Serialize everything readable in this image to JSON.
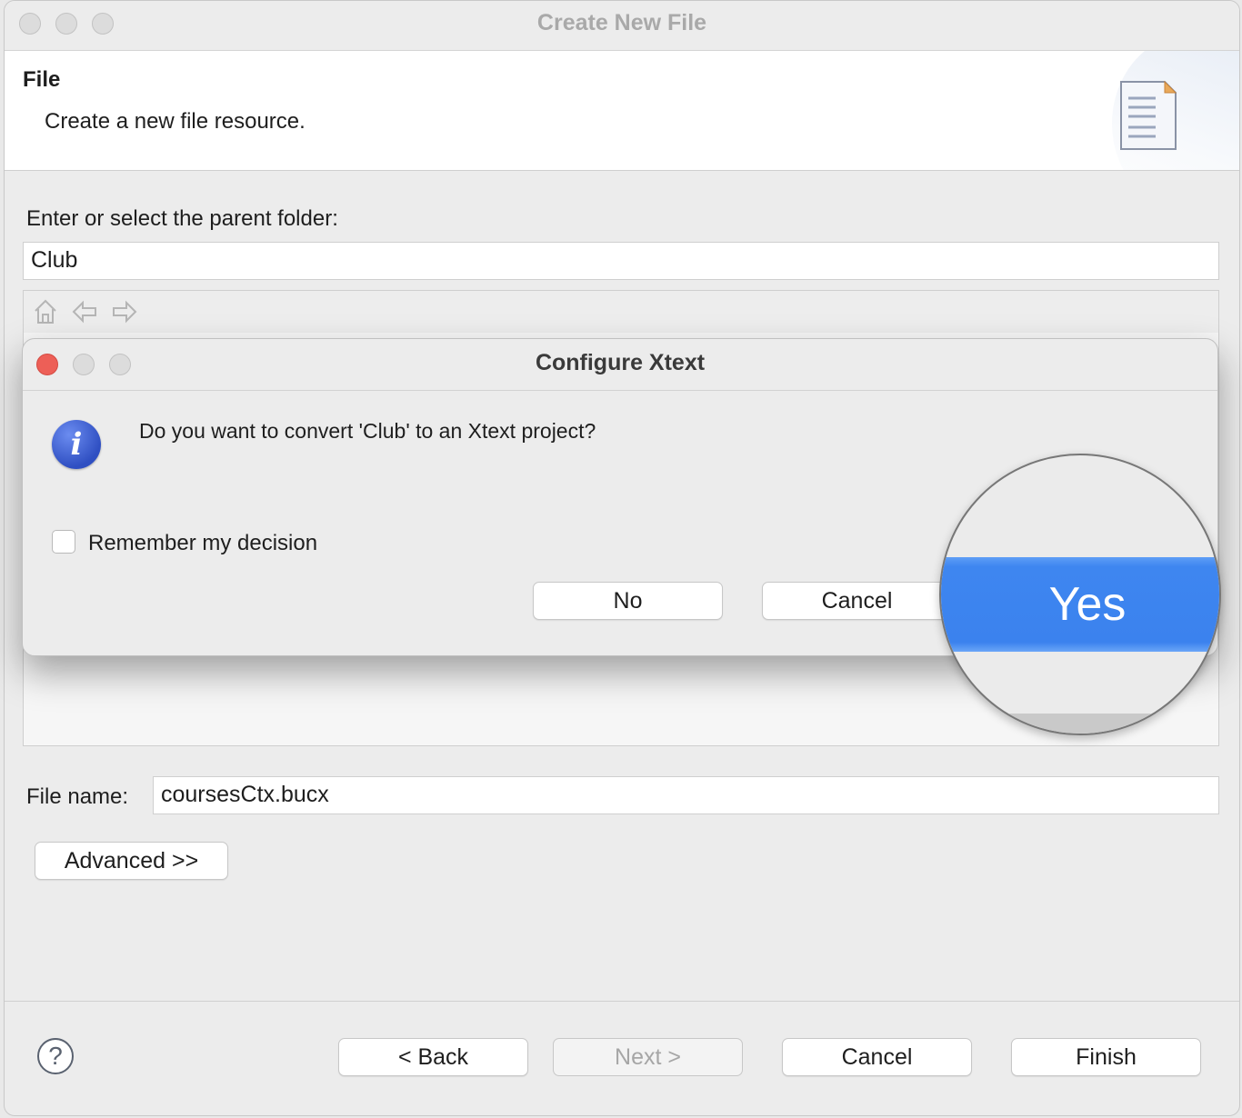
{
  "window": {
    "title": "Create New File"
  },
  "banner": {
    "title": "File",
    "description": "Create a new file resource."
  },
  "parent_folder": {
    "label": "Enter or select the parent folder:",
    "value": "Club"
  },
  "tree_toolbar": {
    "icons": [
      "home-icon",
      "back-arrow-icon",
      "forward-arrow-icon"
    ]
  },
  "file_name": {
    "label": "File name:",
    "value": "coursesCtx.bucx"
  },
  "advanced_button": "Advanced >>",
  "footer": {
    "help_label": "?",
    "back_label": "< Back",
    "next_label": "Next >",
    "cancel_label": "Cancel",
    "finish_label": "Finish"
  },
  "dialog": {
    "title": "Configure Xtext",
    "icon": "info-icon",
    "message": "Do you want to convert 'Club' to an Xtext project?",
    "remember_label": "Remember my decision",
    "remember_checked": false,
    "no_label": "No",
    "cancel_label": "Cancel",
    "yes_label": "Yes"
  },
  "colors": {
    "accent_blue": "#3b82ee",
    "close_red": "#ed5f57"
  }
}
